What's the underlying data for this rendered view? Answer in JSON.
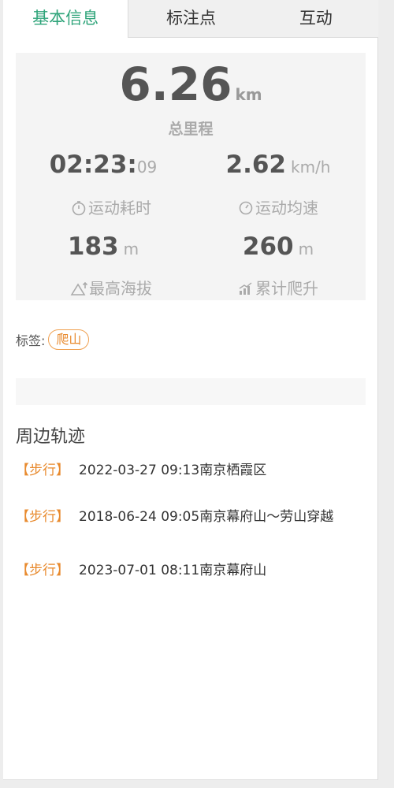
{
  "tabs": [
    {
      "label": "基本信息",
      "active": true
    },
    {
      "label": "标注点",
      "active": false
    },
    {
      "label": "互动",
      "active": false
    }
  ],
  "stats": {
    "total_distance": "6.26",
    "total_distance_unit": "km",
    "total_distance_label": "总里程",
    "duration_main": "02:23:",
    "duration_seconds": "09",
    "duration_label": "运动耗时",
    "avg_speed": "2.62",
    "avg_speed_unit": "km/h",
    "avg_speed_label": "运动均速",
    "max_altitude": "183",
    "max_altitude_unit": "m",
    "max_altitude_label": "最高海拔",
    "total_climb": "260",
    "total_climb_unit": "m",
    "total_climb_label": "累计爬升"
  },
  "tags": {
    "label": "标签:",
    "items": [
      "爬山"
    ]
  },
  "nearby": {
    "title": "周边轨迹",
    "tracks": [
      {
        "type": "【步行】",
        "desc": "2022-03-27 09:13南京栖霞区"
      },
      {
        "type": "【步行】",
        "desc": "2018-06-24 09:05南京幕府山～劳山穿越"
      },
      {
        "type": "【步行】",
        "desc": "2023-07-01 08:11南京幕府山"
      }
    ]
  },
  "colors": {
    "accent": "#2fa47a",
    "tag": "#e88a2e",
    "stat_value": "#555555",
    "muted": "#aaaaaa"
  },
  "icons": [
    "stopwatch-icon",
    "speed-gauge-icon",
    "mountain-altitude-icon",
    "climb-bars-icon"
  ]
}
